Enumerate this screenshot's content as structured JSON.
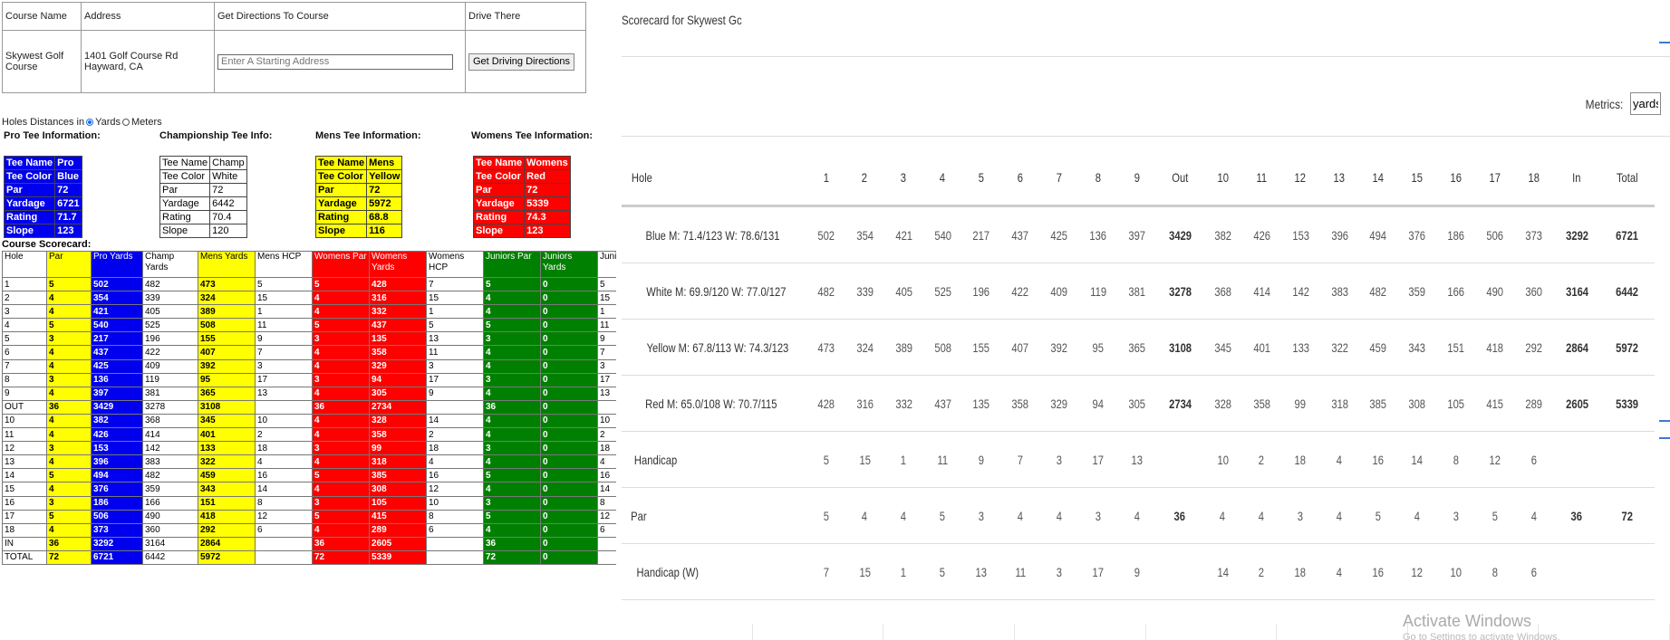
{
  "directions": {
    "headers": [
      "Course Name",
      "Address",
      "Get Directions To Course",
      "Drive There"
    ],
    "course_name": "Skywest Golf Course",
    "address": "1401 Golf Course Rd Hayward, CA",
    "start_placeholder": "Enter A Starting Address",
    "button": "Get Driving Directions"
  },
  "units": {
    "label": "Holes Distances in",
    "yards": "Yards",
    "meters": "Meters",
    "selected": "yards"
  },
  "tee_headings": [
    "Pro Tee Information:",
    "Championship Tee Info:",
    "Mens Tee Information:",
    "Womens Tee Information:"
  ],
  "tees": [
    {
      "rows": [
        [
          "Tee Name",
          "Pro"
        ],
        [
          "Tee Color",
          "Blue"
        ],
        [
          "Par",
          "72"
        ],
        [
          "Yardage",
          "6721"
        ],
        [
          "Rating",
          "71.7"
        ],
        [
          "Slope",
          "123"
        ]
      ]
    },
    {
      "rows": [
        [
          "Tee Name",
          "Champ"
        ],
        [
          "Tee Color",
          "White"
        ],
        [
          "Par",
          "72"
        ],
        [
          "Yardage",
          "6442"
        ],
        [
          "Rating",
          "70.4"
        ],
        [
          "Slope",
          "120"
        ]
      ]
    },
    {
      "rows": [
        [
          "Tee Name",
          "Mens"
        ],
        [
          "Tee Color",
          "Yellow"
        ],
        [
          "Par",
          "72"
        ],
        [
          "Yardage",
          "5972"
        ],
        [
          "Rating",
          "68.8"
        ],
        [
          "Slope",
          "116"
        ]
      ]
    },
    {
      "rows": [
        [
          "Tee Name",
          "Womens"
        ],
        [
          "Tee Color",
          "Red"
        ],
        [
          "Par",
          "72"
        ],
        [
          "Yardage",
          "5339"
        ],
        [
          "Rating",
          "74.3"
        ],
        [
          "Slope",
          "123"
        ]
      ]
    }
  ],
  "scorecard_title": "Course Scorecard:",
  "scorecard": {
    "columns": [
      "Hole",
      "Par",
      "Pro Yards",
      "Champ Yards",
      "Mens Yards",
      "Mens HCP",
      "Womens Par",
      "Womens Yards",
      "Womens HCP",
      "Juniors Par",
      "Juniors Yards",
      "Juniors HCP"
    ],
    "rows": [
      [
        "1",
        "5",
        "502",
        "482",
        "473",
        "5",
        "5",
        "428",
        "7",
        "5",
        "0",
        "5"
      ],
      [
        "2",
        "4",
        "354",
        "339",
        "324",
        "15",
        "4",
        "316",
        "15",
        "4",
        "0",
        "15"
      ],
      [
        "3",
        "4",
        "421",
        "405",
        "389",
        "1",
        "4",
        "332",
        "1",
        "4",
        "0",
        "1"
      ],
      [
        "4",
        "5",
        "540",
        "525",
        "508",
        "11",
        "5",
        "437",
        "5",
        "5",
        "0",
        "11"
      ],
      [
        "5",
        "3",
        "217",
        "196",
        "155",
        "9",
        "3",
        "135",
        "13",
        "3",
        "0",
        "9"
      ],
      [
        "6",
        "4",
        "437",
        "422",
        "407",
        "7",
        "4",
        "358",
        "11",
        "4",
        "0",
        "7"
      ],
      [
        "7",
        "4",
        "425",
        "409",
        "392",
        "3",
        "4",
        "329",
        "3",
        "4",
        "0",
        "3"
      ],
      [
        "8",
        "3",
        "136",
        "119",
        "95",
        "17",
        "3",
        "94",
        "17",
        "3",
        "0",
        "17"
      ],
      [
        "9",
        "4",
        "397",
        "381",
        "365",
        "13",
        "4",
        "305",
        "9",
        "4",
        "0",
        "13"
      ],
      [
        "OUT",
        "36",
        "3429",
        "3278",
        "3108",
        "",
        "36",
        "2734",
        "",
        "36",
        "0",
        ""
      ],
      [
        "10",
        "4",
        "382",
        "368",
        "345",
        "10",
        "4",
        "328",
        "14",
        "4",
        "0",
        "10"
      ],
      [
        "11",
        "4",
        "426",
        "414",
        "401",
        "2",
        "4",
        "358",
        "2",
        "4",
        "0",
        "2"
      ],
      [
        "12",
        "3",
        "153",
        "142",
        "133",
        "18",
        "3",
        "99",
        "18",
        "3",
        "0",
        "18"
      ],
      [
        "13",
        "4",
        "396",
        "383",
        "322",
        "4",
        "4",
        "318",
        "4",
        "4",
        "0",
        "4"
      ],
      [
        "14",
        "5",
        "494",
        "482",
        "459",
        "16",
        "5",
        "385",
        "16",
        "5",
        "0",
        "16"
      ],
      [
        "15",
        "4",
        "376",
        "359",
        "343",
        "14",
        "4",
        "308",
        "12",
        "4",
        "0",
        "14"
      ],
      [
        "16",
        "3",
        "186",
        "166",
        "151",
        "8",
        "3",
        "105",
        "10",
        "3",
        "0",
        "8"
      ],
      [
        "17",
        "5",
        "506",
        "490",
        "418",
        "12",
        "5",
        "415",
        "8",
        "5",
        "0",
        "12"
      ],
      [
        "18",
        "4",
        "373",
        "360",
        "292",
        "6",
        "4",
        "289",
        "6",
        "4",
        "0",
        "6"
      ],
      [
        "IN",
        "36",
        "3292",
        "3164",
        "2864",
        "",
        "36",
        "2605",
        "",
        "36",
        "0",
        ""
      ],
      [
        "TOTAL",
        "72",
        "6721",
        "6442",
        "5972",
        "",
        "72",
        "5339",
        "",
        "72",
        "0",
        ""
      ]
    ]
  },
  "right": {
    "title": "Scorecard for Skywest Gc",
    "metrics_label": "Metrics:",
    "metrics_value": "yards",
    "headers": [
      "Hole",
      "1",
      "2",
      "3",
      "4",
      "5",
      "6",
      "7",
      "8",
      "9",
      "Out",
      "10",
      "11",
      "12",
      "13",
      "14",
      "15",
      "16",
      "17",
      "18",
      "In",
      "Total"
    ],
    "rows": [
      [
        "Blue M: 71.4/123 W: 78.6/131",
        "502",
        "354",
        "421",
        "540",
        "217",
        "437",
        "425",
        "136",
        "397",
        "3429",
        "382",
        "426",
        "153",
        "396",
        "494",
        "376",
        "186",
        "506",
        "373",
        "3292",
        "6721"
      ],
      [
        "White M: 69.9/120 W: 77.0/127",
        "482",
        "339",
        "405",
        "525",
        "196",
        "422",
        "409",
        "119",
        "381",
        "3278",
        "368",
        "414",
        "142",
        "383",
        "482",
        "359",
        "166",
        "490",
        "360",
        "3164",
        "6442"
      ],
      [
        "Yellow M: 67.8/113 W: 74.3/123",
        "473",
        "324",
        "389",
        "508",
        "155",
        "407",
        "392",
        "95",
        "365",
        "3108",
        "345",
        "401",
        "133",
        "322",
        "459",
        "343",
        "151",
        "418",
        "292",
        "2864",
        "5972"
      ],
      [
        "Red M: 65.0/108 W: 70.7/115",
        "428",
        "316",
        "332",
        "437",
        "135",
        "358",
        "329",
        "94",
        "305",
        "2734",
        "328",
        "358",
        "99",
        "318",
        "385",
        "308",
        "105",
        "415",
        "289",
        "2605",
        "5339"
      ],
      [
        "Handicap",
        "5",
        "15",
        "1",
        "11",
        "9",
        "7",
        "3",
        "17",
        "13",
        "",
        "10",
        "2",
        "18",
        "4",
        "16",
        "14",
        "8",
        "12",
        "6",
        "",
        ""
      ],
      [
        "Par",
        "5",
        "4",
        "4",
        "5",
        "3",
        "4",
        "4",
        "3",
        "4",
        "36",
        "4",
        "4",
        "3",
        "4",
        "5",
        "4",
        "3",
        "5",
        "4",
        "36",
        "72"
      ],
      [
        "Handicap (W)",
        "7",
        "15",
        "1",
        "5",
        "13",
        "11",
        "3",
        "17",
        "9",
        "",
        "14",
        "2",
        "18",
        "4",
        "16",
        "12",
        "10",
        "8",
        "6",
        "",
        ""
      ]
    ],
    "watermark": "Activate Windows",
    "watermark_sub": "Go to Settings to activate Windows."
  },
  "colors": {
    "pro_blue": "#0000ee",
    "mens_yellow": "#ffff00",
    "womens_red": "#ff0000",
    "juniors_green": "#008000"
  }
}
